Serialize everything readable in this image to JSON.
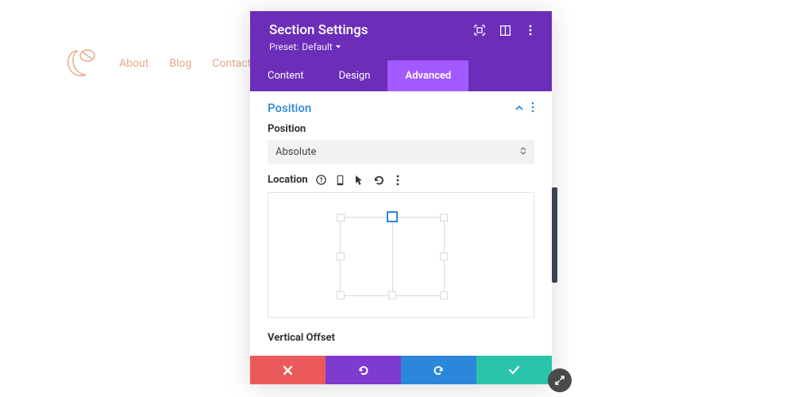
{
  "nav": {
    "links": [
      "About",
      "Blog",
      "Contact"
    ]
  },
  "panel": {
    "title": "Section Settings",
    "preset_label": "Preset:",
    "preset_value": "Default",
    "tabs": {
      "content": "Content",
      "design": "Design",
      "advanced": "Advanced"
    },
    "section": {
      "title": "Position"
    },
    "position": {
      "label": "Position",
      "value": "Absolute"
    },
    "location": {
      "label": "Location"
    },
    "vertical_offset": {
      "label": "Vertical Offset"
    }
  }
}
